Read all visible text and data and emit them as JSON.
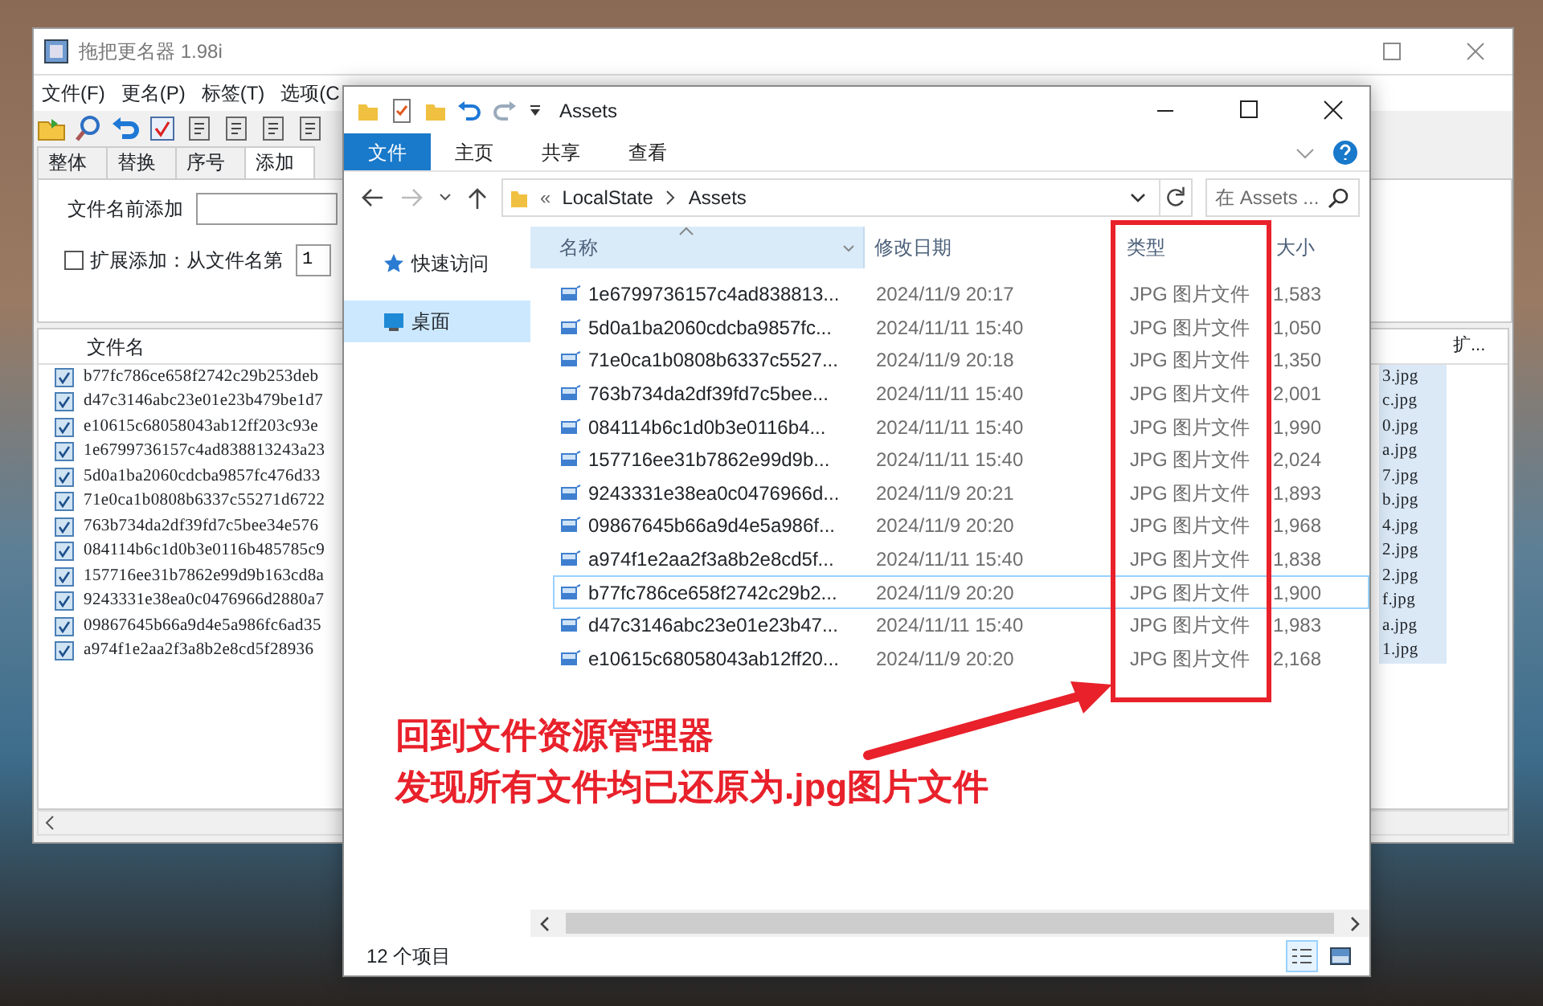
{
  "back_window": {
    "title": "拖把更名器 1.98i",
    "menu": [
      "文件(F)",
      "更名(P)",
      "标签(T)",
      "选项(C"
    ],
    "tabs": [
      {
        "label": "整体",
        "selected": false
      },
      {
        "label": "替换",
        "selected": false
      },
      {
        "label": "序号",
        "selected": false
      },
      {
        "label": "添加",
        "selected": true
      }
    ],
    "prefix_label": "文件名前添加",
    "extend": {
      "checked": false,
      "label": "扩展添加：从文件名第",
      "value": "1"
    },
    "columns": [
      "文件名",
      "扩..."
    ],
    "rows": [
      {
        "checked": true,
        "name_start": "b77fc786ce658f2742c29b253deb",
        "name_end": "3.jpg"
      },
      {
        "checked": true,
        "name_start": "d47c3146abc23e01e23b479be1d7",
        "name_end": "c.jpg"
      },
      {
        "checked": true,
        "name_start": "e10615c68058043ab12ff203c93e",
        "name_end": "0.jpg"
      },
      {
        "checked": true,
        "name_start": "1e6799736157c4ad838813243a23",
        "name_end": "a.jpg"
      },
      {
        "checked": true,
        "name_start": "5d0a1ba2060cdcba9857fc476d33",
        "name_end": "7.jpg"
      },
      {
        "checked": true,
        "name_start": "71e0ca1b0808b6337c55271d6722",
        "name_end": "b.jpg"
      },
      {
        "checked": true,
        "name_start": "763b734da2df39fd7c5bee34e576",
        "name_end": "4.jpg"
      },
      {
        "checked": true,
        "name_start": "084114b6c1d0b3e0116b485785c9",
        "name_end": "2.jpg"
      },
      {
        "checked": true,
        "name_start": "157716ee31b7862e99d9b163cd8a",
        "name_end": "2.jpg"
      },
      {
        "checked": true,
        "name_start": "9243331e38ea0c0476966d2880a7",
        "name_end": "f.jpg"
      },
      {
        "checked": true,
        "name_start": "09867645b66a9d4e5a986fc6ad35",
        "name_end": "a.jpg"
      },
      {
        "checked": true,
        "name_start": "a974f1e2aa2f3a8b2e8cd5f28936",
        "name_end": "1.jpg"
      }
    ]
  },
  "explorer": {
    "title": "Assets",
    "ribbon_tabs": [
      {
        "label": "文件",
        "selected": true
      },
      {
        "label": "主页",
        "selected": false
      },
      {
        "label": "共享",
        "selected": false
      },
      {
        "label": "查看",
        "selected": false
      }
    ],
    "path_prefix": "«",
    "path": [
      "LocalState",
      "Assets"
    ],
    "search": {
      "placeholder": "在 Assets ..."
    },
    "nav": [
      {
        "label": "快速访问",
        "kind": "star",
        "selected": false
      },
      {
        "label": "桌面",
        "kind": "desktop",
        "selected": true
      }
    ],
    "columns": [
      {
        "label": "名称",
        "sorted": true
      },
      {
        "label": "修改日期",
        "sorted": false
      },
      {
        "label": "类型",
        "sorted": false
      },
      {
        "label": "大小",
        "sorted": false
      }
    ],
    "rows": [
      {
        "name": "1e6799736157c4ad838813...",
        "date": "2024/11/9 20:17",
        "type": "JPG 图片文件",
        "size": "1,583",
        "focused": false
      },
      {
        "name": "5d0a1ba2060cdcba9857fc...",
        "date": "2024/11/11 15:40",
        "type": "JPG 图片文件",
        "size": "1,050",
        "focused": false
      },
      {
        "name": "71e0ca1b0808b6337c5527...",
        "date": "2024/11/9 20:18",
        "type": "JPG 图片文件",
        "size": "1,350",
        "focused": false
      },
      {
        "name": "763b734da2df39fd7c5bee...",
        "date": "2024/11/11 15:40",
        "type": "JPG 图片文件",
        "size": "2,001",
        "focused": false
      },
      {
        "name": "084114b6c1d0b3e0116b4...",
        "date": "2024/11/11 15:40",
        "type": "JPG 图片文件",
        "size": "1,990",
        "focused": false
      },
      {
        "name": "157716ee31b7862e99d9b...",
        "date": "2024/11/11 15:40",
        "type": "JPG 图片文件",
        "size": "2,024",
        "focused": false
      },
      {
        "name": "9243331e38ea0c0476966d...",
        "date": "2024/11/9 20:21",
        "type": "JPG 图片文件",
        "size": "1,893",
        "focused": false
      },
      {
        "name": "09867645b66a9d4e5a986f...",
        "date": "2024/11/9 20:20",
        "type": "JPG 图片文件",
        "size": "1,968",
        "focused": false
      },
      {
        "name": "a974f1e2aa2f3a8b2e8cd5f...",
        "date": "2024/11/11 15:40",
        "type": "JPG 图片文件",
        "size": "1,838",
        "focused": false
      },
      {
        "name": "b77fc786ce658f2742c29b2...",
        "date": "2024/11/9 20:20",
        "type": "JPG 图片文件",
        "size": "1,900",
        "focused": true
      },
      {
        "name": "d47c3146abc23e01e23b47...",
        "date": "2024/11/11 15:40",
        "type": "JPG 图片文件",
        "size": "1,983",
        "focused": false
      },
      {
        "name": "e10615c68058043ab12ff20...",
        "date": "2024/11/9 20:20",
        "type": "JPG 图片文件",
        "size": "2,168",
        "focused": false
      }
    ],
    "status": "12 个项目",
    "views": [
      {
        "kind": "details",
        "selected": true
      },
      {
        "kind": "thumbnails",
        "selected": false
      }
    ]
  },
  "annotation": {
    "lines": [
      "回到文件资源管理器",
      "发现所有文件均已还原为.jpg图片文件"
    ]
  }
}
